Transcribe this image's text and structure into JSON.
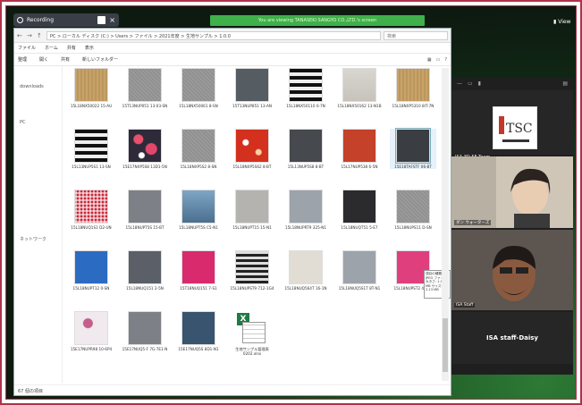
{
  "recording": {
    "label": "Recording"
  },
  "banner": {
    "text": "You are viewing TANASEKI SANGYO CO.,LTD.'s screen"
  },
  "view_button": {
    "label": "View"
  },
  "explorer": {
    "address": "PC  >  ローカル ディスク (C:)  >  Users  >  ファイル  >  2021年度  >  生地サンプル  >  1.0.0",
    "search_placeholder": "検索",
    "menu": [
      "ファイル",
      "ホーム",
      "共有",
      "表示"
    ],
    "toolbar": [
      "整理",
      "開く",
      "共有",
      "新しいフォルダー"
    ],
    "nav_items": [
      "downloads",
      "PC",
      "ネットワーク"
    ],
    "status": "67 個の項目",
    "files": [
      {
        "name": "15L18NX50022 15-AU",
        "swatch": "tan"
      },
      {
        "name": "15T13NUP051 13:03-SN",
        "swatch": "grey"
      },
      {
        "name": "15L18NX50061 8-SN",
        "swatch": "grey"
      },
      {
        "name": "15T13NUP851 13-AN",
        "swatch": "darkgrey"
      },
      {
        "name": "15L18NX50110 0-7N",
        "swatch": "stripe-bw"
      },
      {
        "name": "15L18NX50162 13-N1B",
        "swatch": "light"
      },
      {
        "name": "15L18NXP5310 8IT-7N",
        "swatch": "tan"
      },
      {
        "name": "15L13NUP5S1 13-SN",
        "swatch": "stripe-bw"
      },
      {
        "name": "15E17NXP5S8 13D1-5N",
        "swatch": "floral"
      },
      {
        "name": "15L18NXP5S2 8-SN",
        "swatch": "grey"
      },
      {
        "name": "15L18NXP5S62 8-BT",
        "swatch": "redfloral"
      },
      {
        "name": "15L13NUP5S8 8-BT",
        "swatch": "dgrey2"
      },
      {
        "name": "15L17NUP538 6-5N",
        "swatch": "rust"
      },
      {
        "name": "15E18TAFSTF 06-BT",
        "swatch": "charcoal"
      },
      {
        "name": "15L18NUQ1S1 D2-UN",
        "swatch": "gingham"
      },
      {
        "name": "15L18NUPT5S 15-BT",
        "swatch": "mid"
      },
      {
        "name": "15L18NUPT5S C5-N1",
        "swatch": "blueish"
      },
      {
        "name": "15L18NUPT15 15-N1",
        "swatch": "silver"
      },
      {
        "name": "15L18NUPRT9 325-N1",
        "swatch": "steel"
      },
      {
        "name": "15L18NUQT51 5-E7",
        "swatch": "black2"
      },
      {
        "name": "15L18NUPS11 D-SN",
        "swatch": "grey"
      },
      {
        "name": "15L18NUPT12 0-SN",
        "swatch": "royal"
      },
      {
        "name": "15L18NUQ151 2-5N",
        "swatch": "slate"
      },
      {
        "name": "15T18NUQ151 7-S1",
        "swatch": "magenta"
      },
      {
        "name": "15L18NUPST9 712-1G4",
        "swatch": "stripe2"
      },
      {
        "name": "15L18NUQ564T 16-1N",
        "swatch": "cream"
      },
      {
        "name": "15L18NUQ5S1T 8T-N1",
        "swatch": "steel"
      },
      {
        "name": "15L18NUPST2 40-BT",
        "swatch": "pinkr"
      },
      {
        "name": "15E17NUPR98 10-6P4",
        "swatch": "rosefloral"
      },
      {
        "name": "15E17NUQ5-F 7G-7E1-N",
        "swatch": "mid"
      },
      {
        "name": "15E17NUQ5S 8D1-N1",
        "swatch": "teal"
      },
      {
        "name": "生地サンプル管理表 0202.xlsx",
        "swatch": "excel"
      }
    ],
    "tooltip": "項目の種類: JPEG ファイル 大きさ: 1.07 MB サイズ: 2.13 MB"
  },
  "zoom_panel": {
    "self_name": "ISA 3D 5F Team",
    "logo_text": "TSC",
    "tile1_label": "ダン ウォーターズ",
    "tile2_label": "ISA Staff",
    "empty_label": "ISA staff-Daisy"
  }
}
